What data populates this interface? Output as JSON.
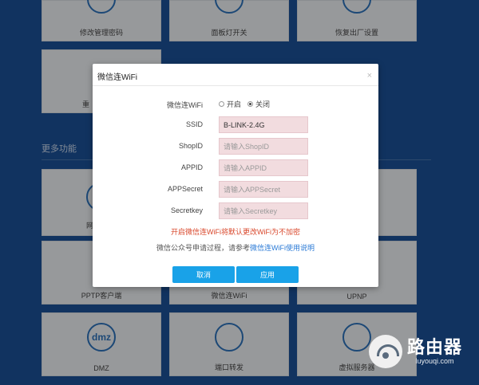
{
  "tiles": {
    "change_password": "修改管理密码",
    "led_switch": "面板灯开关",
    "factory_reset": "恢复出厂设置",
    "reboot": "重",
    "more_partial": "网",
    "pptp_client": "PPTP客户端",
    "wechat_wifi": "微信连WiFi",
    "upnp": "UPNP",
    "dmz": "DMZ",
    "dmz_icon_text": "dmz",
    "port_forward": "端口转发",
    "virtual_server": "虚拟服务器"
  },
  "section": {
    "more_features": "更多功能"
  },
  "modal": {
    "title": "微信连WiFi",
    "close": "×",
    "wechat_label": "微信连WiFi",
    "radio_on": "开启",
    "radio_off": "关闭",
    "selected": "关闭",
    "ssid_label": "SSID",
    "ssid_value": "B-LINK-2.4G",
    "shopid_label": "ShopID",
    "shopid_placeholder": "请输入ShopID",
    "appid_label": "APPID",
    "appid_placeholder": "请输入APPID",
    "appsecret_label": "APPSecret",
    "appsecret_placeholder": "请输入APPSecret",
    "secretkey_label": "Secretkey",
    "secretkey_placeholder": "请输入Secretkey",
    "warning": "开启微信连WiFi将默认更改WiFi为不加密",
    "hint_prefix": "微信公众号申请过程，请参考",
    "hint_link": "微信连WiFi使用说明",
    "cancel": "取消",
    "apply": "应用"
  },
  "watermark": {
    "title": "路由器",
    "subtitle": "luyouqi.com"
  },
  "colors": {
    "background": "#1b4f94",
    "accent_button": "#19a2e8",
    "warning": "#d9472b",
    "link": "#2a7ad6",
    "input_bg": "#f2dcdf"
  }
}
